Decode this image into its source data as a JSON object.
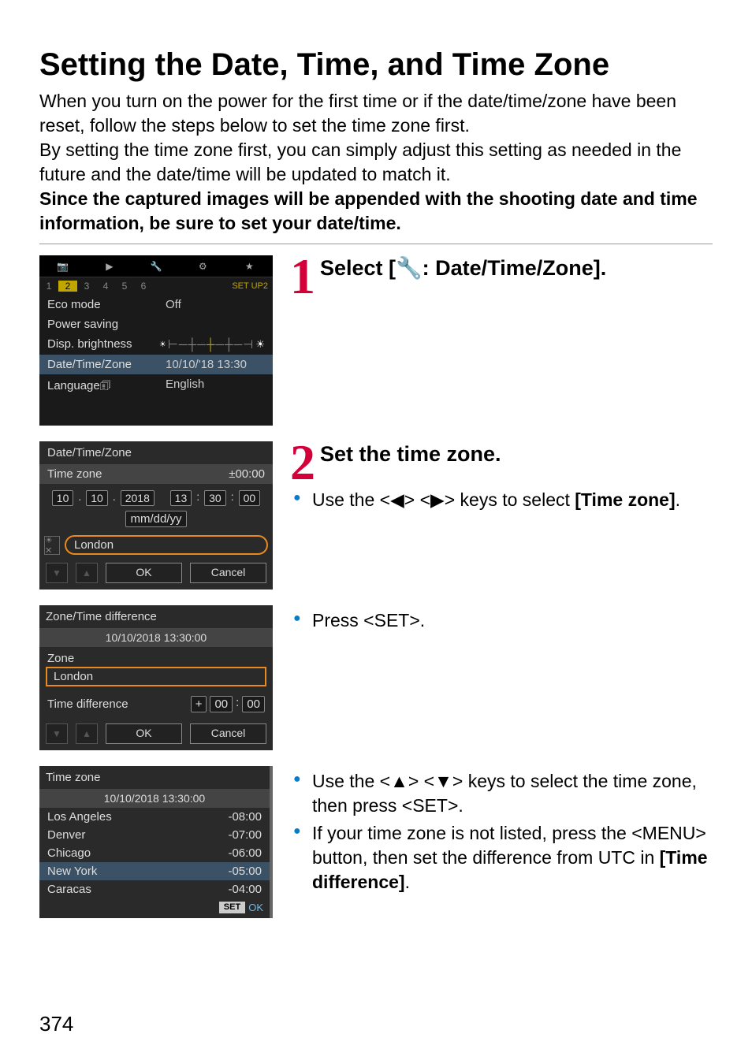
{
  "title": "Setting the Date, Time, and Time Zone",
  "intro": {
    "p1": "When you turn on the power for the first time or if the date/time/zone have been reset, follow the steps below to set the time zone first.",
    "p2": "By setting the time zone first, you can simply adjust this setting as needed in the future and the date/time will be updated to match it.",
    "p3": "Since the captured images will be appended with the shooting date and time information, be sure to set your date/time."
  },
  "step1": {
    "num": "1",
    "title_pre": "Select [",
    "title_icon": "🔧",
    "title_post": ": Date/Time/Zone].",
    "menu": {
      "tabs": {
        "camera": "📷",
        "play": "▶",
        "wrench": "🔧",
        "cog": "⚙",
        "star": "★"
      },
      "subtabs": [
        "1",
        "2",
        "3",
        "4",
        "5",
        "6"
      ],
      "subtab_label": "SET UP2",
      "items": [
        {
          "k": "Eco mode",
          "v": "Off"
        },
        {
          "k": "Power saving",
          "v": ""
        },
        {
          "k": "Disp. brightness",
          "v": "slider"
        },
        {
          "k": "Date/Time/Zone",
          "v": "10/10/'18 13:30",
          "hl": true
        },
        {
          "k": "Language",
          "v": "English",
          "icon": "🗊"
        }
      ]
    }
  },
  "step2": {
    "num": "2",
    "title": "Set the time zone.",
    "bullet1a": "Use the <◀> <▶> keys to select ",
    "bullet1b": "[Time zone]",
    "bullet1c": ".",
    "bullet2": "Press <SET>.",
    "bullet3": "Use the <▲> <▼> keys to select the time zone, then press <SET>.",
    "bullet4a": "If your time zone is not listed, press the <",
    "bullet4b": "MENU",
    "bullet4c": "> button, then set the difference from UTC in ",
    "bullet4d": "[Time difference]",
    "bullet4e": ".",
    "panel2": {
      "title": "Date/Time/Zone",
      "tz_label": "Time zone",
      "tz_value": "±00:00",
      "date": {
        "m": "10",
        "d": "10",
        "y": "2018"
      },
      "time": {
        "h": "13",
        "mi": "30",
        "s": "00"
      },
      "fmt": "mm/dd/yy",
      "city": "London",
      "ok": "OK",
      "cancel": "Cancel"
    },
    "panel3": {
      "title": "Zone/Time difference",
      "dt": "10/10/2018 13:30:00",
      "zone_label": "Zone",
      "zone_value": "London",
      "diff_label": "Time difference",
      "diff_sign": "+",
      "diff_h": "00",
      "diff_m": "00",
      "ok": "OK",
      "cancel": "Cancel"
    },
    "panel4": {
      "title": "Time zone",
      "dt": "10/10/2018 13:30:00",
      "rows": [
        {
          "city": "Los Angeles",
          "off": "-08:00"
        },
        {
          "city": "Denver",
          "off": "-07:00"
        },
        {
          "city": "Chicago",
          "off": "-06:00"
        },
        {
          "city": "New York",
          "off": "-05:00",
          "hl": true
        },
        {
          "city": "Caracas",
          "off": "-04:00"
        }
      ],
      "set": "SET",
      "ok": "OK"
    }
  },
  "page_number": "374"
}
